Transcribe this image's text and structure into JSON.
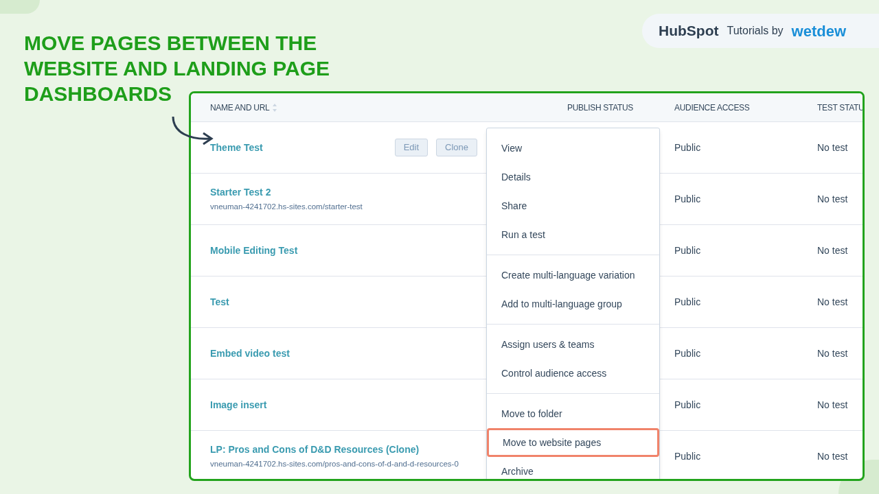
{
  "headline": "MOVE PAGES BETWEEN THE WEBSITE AND LANDING PAGE DASHBOARDS",
  "brand": {
    "logo": "HubSpot",
    "tagline": "Tutorials by",
    "partner": "wetdew"
  },
  "table": {
    "columns": [
      {
        "label": "NAME AND URL",
        "sortable": true
      },
      {
        "label": "PUBLISH STATUS",
        "sortable": false
      },
      {
        "label": "AUDIENCE ACCESS",
        "sortable": false
      },
      {
        "label": "TEST STATU",
        "sortable": false
      }
    ],
    "rows": [
      {
        "name": "Theme Test",
        "actions": [
          "Edit",
          "Clone"
        ],
        "audience": "Public",
        "test": "No test"
      },
      {
        "name": "Starter Test 2",
        "url": "vneuman-4241702.hs-sites.com/starter-test",
        "audience": "Public",
        "test": "No test"
      },
      {
        "name": "Mobile Editing Test",
        "audience": "Public",
        "test": "No test"
      },
      {
        "name": "Test",
        "audience": "Public",
        "test": "No test"
      },
      {
        "name": "Embed video test",
        "audience": "Public",
        "test": "No test"
      },
      {
        "name": "Image insert",
        "audience": "Public",
        "test": "No test"
      },
      {
        "name": "LP: Pros and Cons of D&D Resources (Clone)",
        "url": "vneuman-4241702.hs-sites.com/pros-and-cons-of-d-and-d-resources-0",
        "audience": "Public",
        "test": "No test"
      }
    ]
  },
  "menu": {
    "groups": [
      [
        {
          "label": "View",
          "highlighted": false
        },
        {
          "label": "Details",
          "highlighted": false
        },
        {
          "label": "Share",
          "highlighted": false
        },
        {
          "label": "Run a test",
          "highlighted": false
        }
      ],
      [
        {
          "label": "Create multi-language variation",
          "highlighted": false
        },
        {
          "label": "Add to multi-language group",
          "highlighted": false
        }
      ],
      [
        {
          "label": "Assign users & teams",
          "highlighted": false
        },
        {
          "label": "Control audience access",
          "highlighted": false
        }
      ],
      [
        {
          "label": "Move to folder",
          "highlighted": false
        },
        {
          "label": "Move to website pages",
          "highlighted": true
        },
        {
          "label": "Archive",
          "highlighted": false
        }
      ]
    ]
  }
}
